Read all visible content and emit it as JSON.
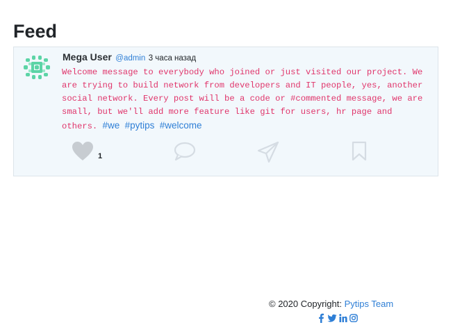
{
  "page": {
    "title": "Feed"
  },
  "post": {
    "author_name": "Mega User",
    "author_handle": "@admin",
    "timestamp": "3 часа назад",
    "body_text": "Welcome message to everybody who joined or just visited our project. We are trying to build network from developers and IT people, yes, another social network. Every post will be a code or #commented message, we are small, but we'll add more feature like git for users, hr page and others.",
    "hashtags": [
      "#we",
      "#pytips",
      "#welcome"
    ],
    "like_count": "1"
  },
  "icons": [
    "heart-icon",
    "comment-icon",
    "share-icon",
    "bookmark-icon",
    "facebook-icon",
    "twitter-icon",
    "linkedin-icon",
    "instagram-icon"
  ],
  "footer": {
    "copyright": "© 2020 Copyright:",
    "team_link": "Pytips Team"
  },
  "colors": {
    "link": "#2f7fd6",
    "code_text": "#e0356b",
    "card_bg": "#f2f8fc",
    "icon_muted": "#d5dce3",
    "heart": "#c7ccd1"
  }
}
